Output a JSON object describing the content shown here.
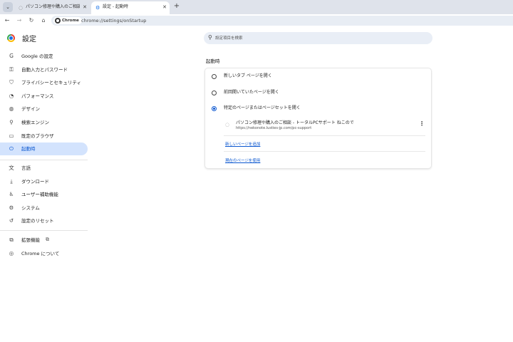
{
  "tabs": [
    {
      "title": "パソコン修理や購入のご相談 - トータ",
      "icon": "globe-icon",
      "active": false
    },
    {
      "title": "設定 - 起動時",
      "icon": "gear-icon",
      "active": true
    }
  ],
  "toolbar": {
    "chip_label": "Chrome",
    "url": "chrome://settings/onStartup"
  },
  "brand": {
    "title": "設定"
  },
  "sidebar": {
    "items": [
      {
        "label": "Google の設定",
        "icon": "google-icon",
        "glyph": "G"
      },
      {
        "label": "自動入力とパスワード",
        "icon": "key-icon",
        "glyph": "⚿"
      },
      {
        "label": "プライバシーとセキュリティ",
        "icon": "shield-icon",
        "glyph": "⛉"
      },
      {
        "label": "パフォーマンス",
        "icon": "speedometer-icon",
        "glyph": "◔"
      },
      {
        "label": "デザイン",
        "icon": "palette-icon",
        "glyph": "◍"
      },
      {
        "label": "検索エンジン",
        "icon": "search-icon",
        "glyph": "⚲"
      },
      {
        "label": "既定のブラウザ",
        "icon": "browser-icon",
        "glyph": "▭"
      },
      {
        "label": "起動時",
        "icon": "power-icon",
        "glyph": "⏻"
      }
    ],
    "items2": [
      {
        "label": "言語",
        "icon": "translate-icon",
        "glyph": "文"
      },
      {
        "label": "ダウンロード",
        "icon": "download-icon",
        "glyph": "⤓"
      },
      {
        "label": "ユーザー補助機能",
        "icon": "accessibility-icon",
        "glyph": "♿"
      },
      {
        "label": "システム",
        "icon": "wrench-icon",
        "glyph": "⚙"
      },
      {
        "label": "設定のリセット",
        "icon": "reset-icon",
        "glyph": "↺"
      }
    ],
    "items3": [
      {
        "label": "拡張機能",
        "icon": "puzzle-icon",
        "glyph": "⧉"
      },
      {
        "label": "Chrome について",
        "icon": "chrome-icon",
        "glyph": "◎"
      }
    ],
    "selected_index": 7
  },
  "search": {
    "placeholder": "設定項目を検索"
  },
  "main": {
    "section_title": "起動時",
    "options": [
      {
        "label": "新しいタブ ページを開く",
        "checked": false
      },
      {
        "label": "前回開いていたページを開く",
        "checked": false
      },
      {
        "label": "特定のページまたはページセットを開く",
        "checked": true
      }
    ],
    "page": {
      "title": "パソコン修理や購入のご相談 - トータルPCサポート ねこので",
      "url": "https://nekonote.lusties-jp.com/pc-support"
    },
    "add_page_link": "新しいページを追加",
    "use_current_link": "現在のページを使用"
  },
  "colors": {
    "accent": "#0b57d0",
    "selected_bg": "#d3e3fd"
  }
}
